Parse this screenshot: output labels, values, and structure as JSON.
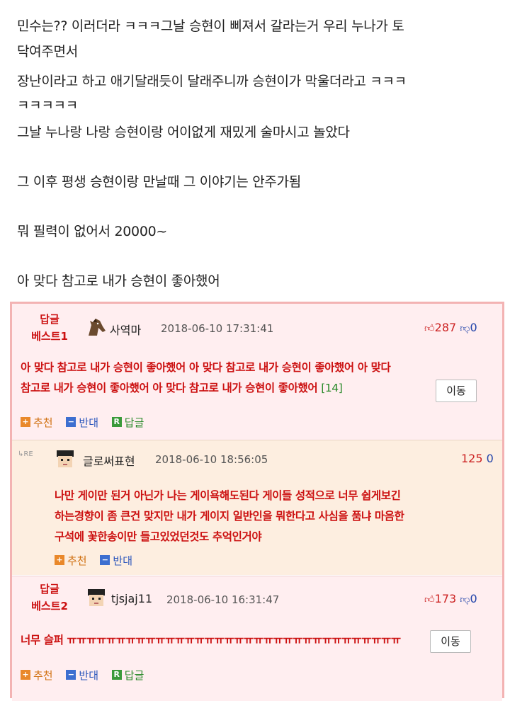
{
  "post": {
    "lines": [
      "민수는?? 이러더라 ㅋㅋㅋ그날 승현이 삐져서 갈라는거 우리 누나가 토",
      "닥여주면서",
      "장난이라고 하고 애기달래듯이 달래주니까 승현이가 막울더라고 ㅋㅋㅋ",
      "ㅋㅋㅋㅋㅋ",
      "그날 누나랑 나랑 승현이랑 어이없게 재밌게 술마시고 놀았다",
      "그 이후 평생 승현이랑 만날때 그 이야기는 안주가됨",
      "뭐 필력이 없어서 20000~",
      "아 맞다 참고로 내가 승현이 좋아했어"
    ]
  },
  "comments": {
    "best1": {
      "badge_top": "답글",
      "badge_bottom": "베스트1",
      "nickname": "사역마",
      "date": "2018-06-10 17:31:41",
      "up": "287",
      "down": "0",
      "text_line1": "아 맞다 참고로 내가 승현이 좋아했어 아 맞다 참고로 내가 승현이 좋아했어 아 맞다",
      "text_line2": "참고로 내가 승현이 좋아했어 아 맞다 참고로 내가 승현이 좋아했어",
      "reply_count": "[14]",
      "move_label": "이동",
      "recommend": "추천",
      "oppose": "반대",
      "reply": "답글"
    },
    "reply": {
      "re_label": "RE",
      "nickname": "글로써표현",
      "date": "2018-06-10 18:56:05",
      "up": "125",
      "down": "0",
      "text_line1": "나만 게이만 된거 아닌가 나는 게이욕해도된다 게이들 성적으로 너무 쉽게보긴",
      "text_line2": "하는경향이 좀 큰건 맞지만 내가 게이지 일반인을 뭐한다고 사심을 품냐 마음한",
      "text_line3": "구석에 꽃한송이만 들고있었던것도 추억인거야",
      "recommend": "추천",
      "oppose": "반대"
    },
    "best2": {
      "badge_top": "답글",
      "badge_bottom": "베스트2",
      "nickname": "tjsjaj11",
      "date": "2018-06-10 16:31:47",
      "up": "173",
      "down": "0",
      "text": "너무 슬퍼 ㅠㅠㅠㅠㅠㅠㅠㅠㅠㅠㅠㅠㅠㅠㅠㅠㅠㅠㅠㅠㅠㅠㅠㅠㅠㅠㅠㅠㅠㅠㅠㅠㅠㅠ",
      "move_label": "이동",
      "recommend": "추천",
      "oppose": "반대",
      "reply": "답글"
    }
  }
}
